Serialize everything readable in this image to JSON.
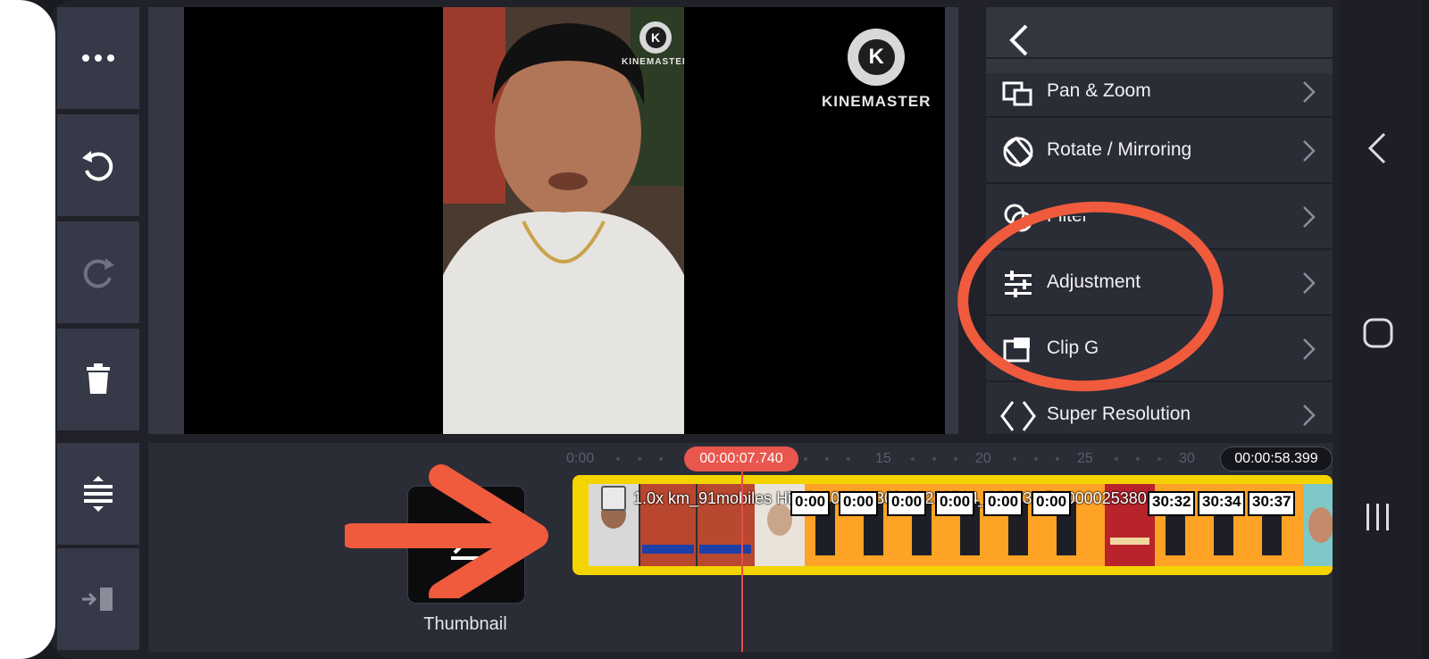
{
  "app": {
    "name": "KineMaster"
  },
  "toolbar": {
    "more_icon": "more-dots-icon",
    "undo_icon": "undo-icon",
    "redo_icon": "redo-icon",
    "delete_icon": "trash-icon",
    "expand_icon": "expand-timeline-icon",
    "export_icon": "export-icon"
  },
  "preview": {
    "watermark_small": "KINEMASTER",
    "watermark_large": "KINEMASTER",
    "logo_letter": "K"
  },
  "menu": {
    "back_icon": "chevron-left-icon",
    "items": [
      {
        "label": "Pan & Zoom",
        "icon": "pan-zoom-icon"
      },
      {
        "label": "Rotate / Mirroring",
        "icon": "rotate-icon"
      },
      {
        "label": "Filter",
        "icon": "filter-icon"
      },
      {
        "label": "Adjustment",
        "icon": "sliders-icon"
      },
      {
        "label": "Clip Graphics",
        "icon": "clip-graphics-icon"
      },
      {
        "label": "Super Resolution",
        "icon": "super-resolution-icon"
      }
    ]
  },
  "timeline": {
    "start_label": "0:00",
    "ticks": [
      "15",
      "20",
      "25",
      "30"
    ],
    "current_time": "00:00:07.740",
    "total_time": "00:00:58.399",
    "clip_label": "1.0x km_91mobiles Hindi_1080p_30f_20230714_154736@1000025380.mp4",
    "frame_times": [
      "0:00",
      "0:00",
      "0:00",
      "0:00",
      "0:00",
      "0:00",
      "30:32",
      "30:34",
      "30:37"
    ],
    "thumbnail_label": "Thumbnail"
  },
  "annotation": {
    "color": "#ef5b3c"
  },
  "system_nav": {
    "back": "back-icon",
    "home": "home-icon",
    "recents": "recents-icon"
  }
}
